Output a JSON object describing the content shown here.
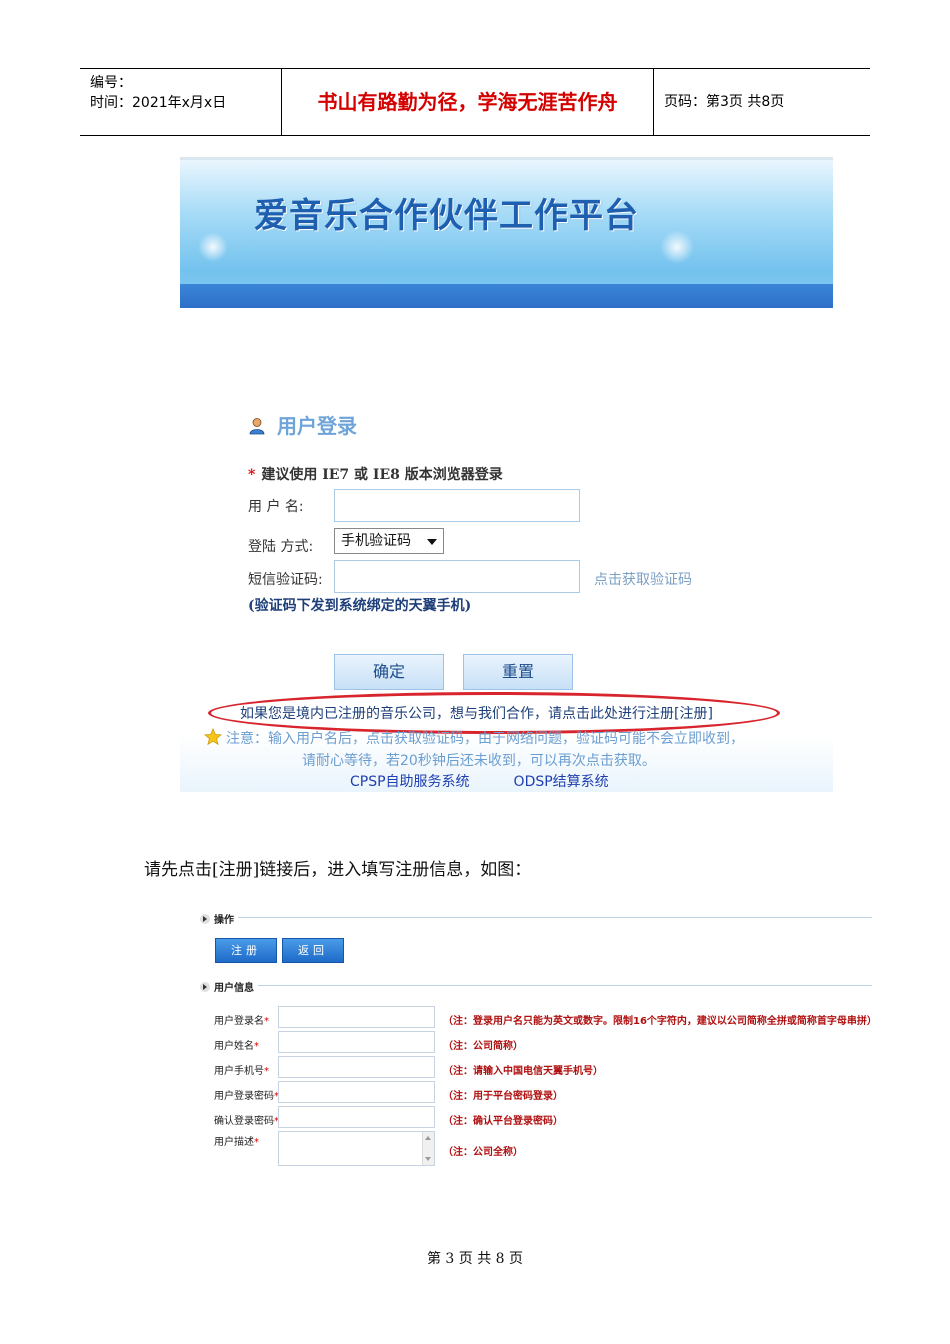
{
  "header": {
    "number_label": "编号：",
    "time_label": "时间：2021年x月x日",
    "motto": "书山有路勤为径，学海无涯苦作舟",
    "page_info": "页码：第3页  共8页"
  },
  "banner": {
    "title": "爱音乐合作伙伴工作平台"
  },
  "login": {
    "title": "用户登录",
    "browser_hint_star": "*",
    "browser_hint": "建议使用 IE7 或 IE8 版本浏览器登录",
    "username_label": "用  户  名:",
    "login_method_label": "登陆 方式:",
    "login_method_value": "手机验证码",
    "sms_code_label": "短信验证码:",
    "get_code_link": "点击获取验证码",
    "code_note": "(验证码下发到系统绑定的天翼手机)",
    "confirm_button": "确定",
    "reset_button": "重置",
    "register_link": "如果您是境内已注册的音乐公司，想与我们合作，请点击此处进行注册[注册]",
    "notice_line1": "注意：输入用户名后，点击获取验证码，由于网络问题，验证码可能不会立即收到，",
    "notice_line2": "请耐心等待，若20秒钟后还未收到，可以再次点击获取。",
    "link_cpsp": "CPSP自助服务系统",
    "link_odsp": "ODSP结算系统"
  },
  "body_text": "请先点击[注册]链接后，进入填写注册信息，如图：",
  "register_form": {
    "section_operation": "操作",
    "register_button": "注册",
    "back_button": "返回",
    "section_user_info": "用户信息",
    "required_mark": "*",
    "fields": [
      {
        "label": "用户登录名",
        "note": "（注：登录用户名只能为英文或数字。限制16个字符内，建议以公司简称全拼或简称首字母串拼）"
      },
      {
        "label": "用户姓名",
        "note": "（注：公司简称）"
      },
      {
        "label": "用户手机号",
        "note": "（注：请输入中国电信天翼手机号）"
      },
      {
        "label": "用户登录密码",
        "note": "（注：用于平台密码登录）"
      },
      {
        "label": "确认登录密码",
        "note": "（注：确认平台登录密码）"
      },
      {
        "label": "用户描述",
        "note": "（注：公司全称）"
      }
    ]
  },
  "footer": "第 3 页 共 8 页",
  "colors": {
    "motto_red": "#d40000",
    "oval_red": "#d8242c",
    "banner_blue": "#1f5fb0",
    "link_blue": "#1f3fb0"
  }
}
